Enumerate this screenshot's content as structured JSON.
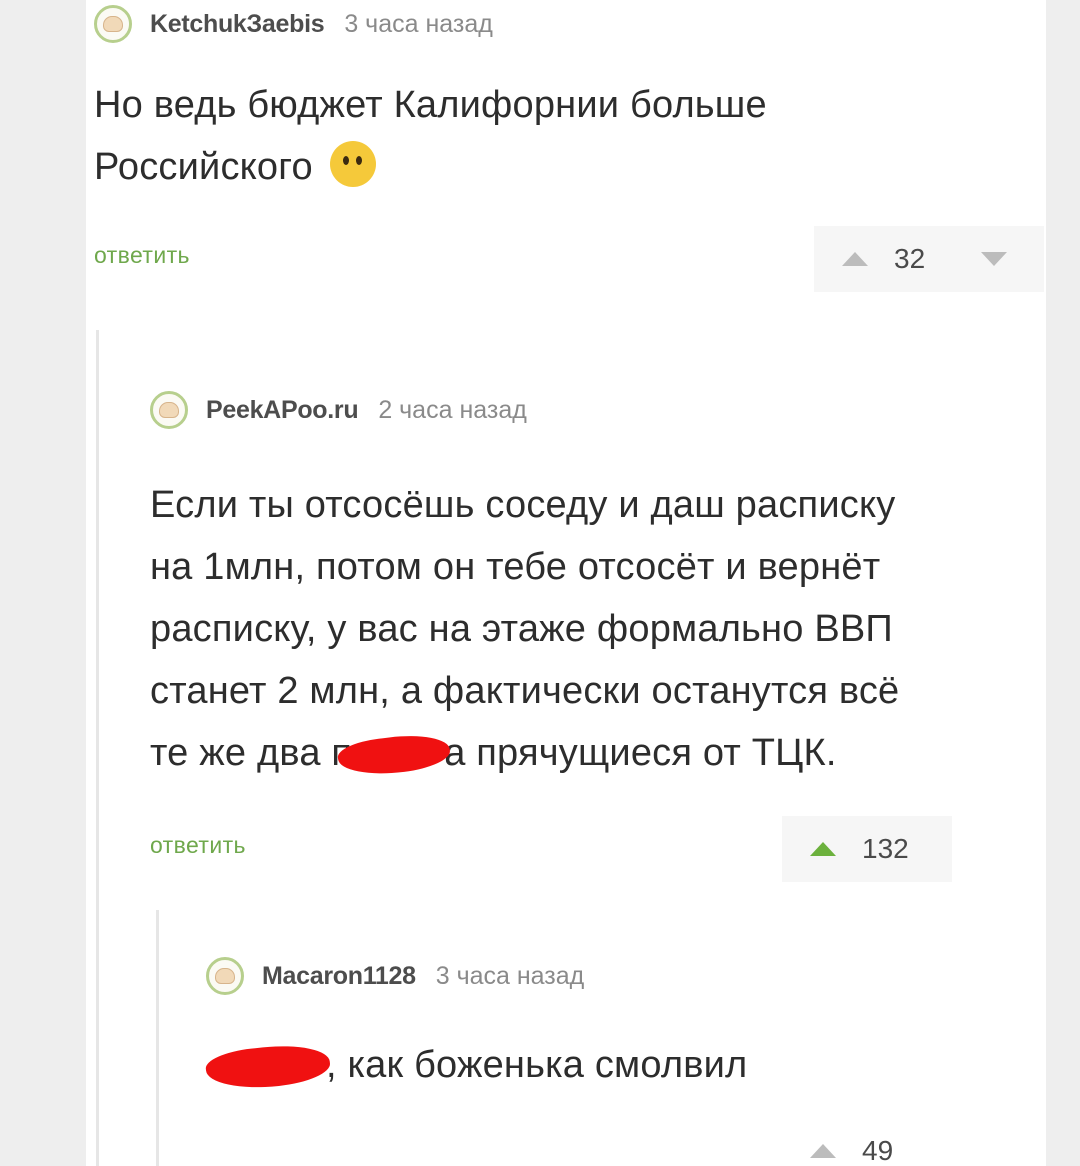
{
  "comments": [
    {
      "author": "KetchukЗaebis",
      "time": "3 часа назад",
      "text_line1": "Но ведь бюджет Калифорнии больше",
      "text_line2": "Российского",
      "emoji": "thinking-face-icon",
      "reply_label": "ответить",
      "score": "32"
    },
    {
      "author": "PeekAPoo.ru",
      "time": "2 часа назад",
      "lines": [
        "Если ты отсосёшь соседу и даш расписку",
        "на 1млн, потом он тебе отсосёт и вернёт",
        "расписку, у вас на этаже формально ВВП",
        "станет 2 млн, а фактически останутся всё"
      ],
      "line5_before": "те же два п",
      "line5_after": "а прячущиеся от ТЦК.",
      "reply_label": "ответить",
      "score": "132"
    },
    {
      "author": "Macaron1128",
      "time": "3 часа назад",
      "text_after": ", как боженька смолвил",
      "score": "49"
    }
  ],
  "colors": {
    "reply": "#6fa84c",
    "upvote_active": "#6cb13d",
    "redaction": "#f01111"
  }
}
